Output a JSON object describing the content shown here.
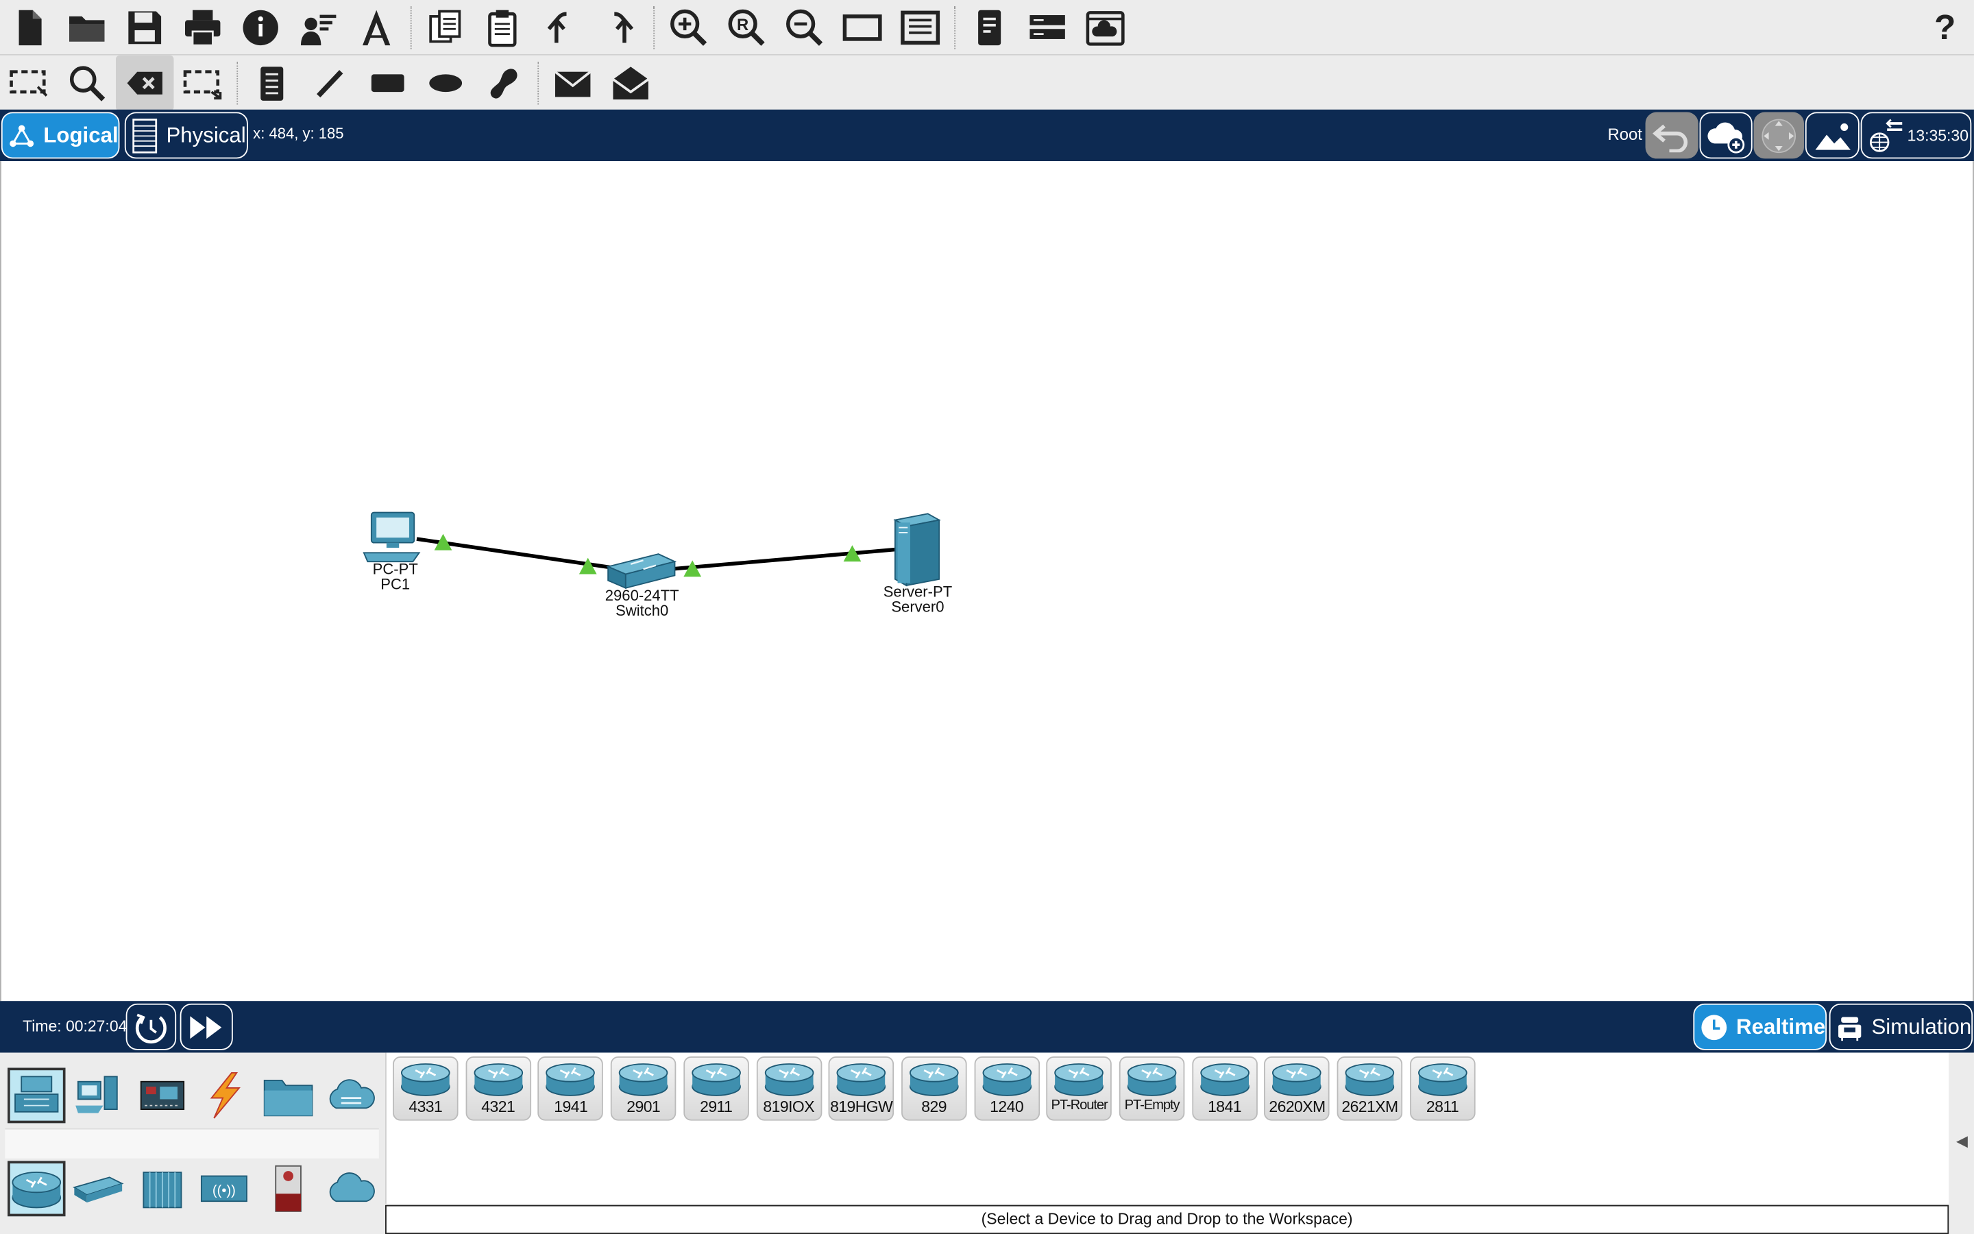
{
  "toolbar_main": {
    "icons": [
      "new-file-icon",
      "open-folder-icon",
      "save-icon",
      "print-icon",
      "info-icon",
      "activity-wizard-icon",
      "network-information-icon",
      "copy-icon",
      "paste-icon",
      "undo-icon",
      "redo-icon",
      "zoom-in-icon",
      "zoom-reset-icon",
      "zoom-out-icon",
      "drawing-palette-icon",
      "custom-device-dialog-icon",
      "pdu-list-icon",
      "viewport-icon",
      "cloud-view-icon"
    ],
    "help": "?"
  },
  "toolbar_tools": {
    "icons": [
      "select-icon",
      "inspect-icon",
      "delete-icon",
      "resize-shape-icon",
      "place-note-icon",
      "draw-line-icon",
      "draw-rectangle-icon",
      "draw-ellipse-icon",
      "draw-freeform-icon",
      "add-simple-pdu-icon",
      "add-complex-pdu-icon"
    ]
  },
  "view_bar": {
    "logical_label": "Logical",
    "physical_label": "Physical",
    "coords": "x: 484, y: 185",
    "root_label": "Root",
    "clock": "13:35:30"
  },
  "workspace": {
    "devices": [
      {
        "model": "PC-PT",
        "name": "PC1"
      },
      {
        "model": "2960-24TT",
        "name": "Switch0"
      },
      {
        "model": "Server-PT",
        "name": "Server0"
      }
    ],
    "link_status_color": "#5fc53c"
  },
  "time_bar": {
    "time": "Time: 00:27:04",
    "realtime_label": "Realtime",
    "simulation_label": "Simulation"
  },
  "device_panel": {
    "categories_top": [
      "network-devices-icon",
      "end-devices-icon",
      "components-icon",
      "connections-icon",
      "miscellaneous-icon",
      "multiuser-connection-icon"
    ],
    "categories_sub": [
      "routers-icon",
      "switches-icon",
      "hubs-icon",
      "wireless-devices-icon",
      "security-icon",
      "wan-emulation-icon"
    ],
    "routers": [
      "4331",
      "4321",
      "1941",
      "2901",
      "2911",
      "819IOX",
      "819HGW",
      "829",
      "1240",
      "PT-Router",
      "PT-Empty",
      "1841",
      "2620XM",
      "2621XM",
      "2811"
    ],
    "hint": "(Select a Device to Drag and Drop to the Workspace)"
  },
  "colors": {
    "bar_blue": "#0d2a52",
    "accent": "#1d8fd8",
    "toolbar": "#ececec",
    "device_teal": "#3f8fae"
  }
}
